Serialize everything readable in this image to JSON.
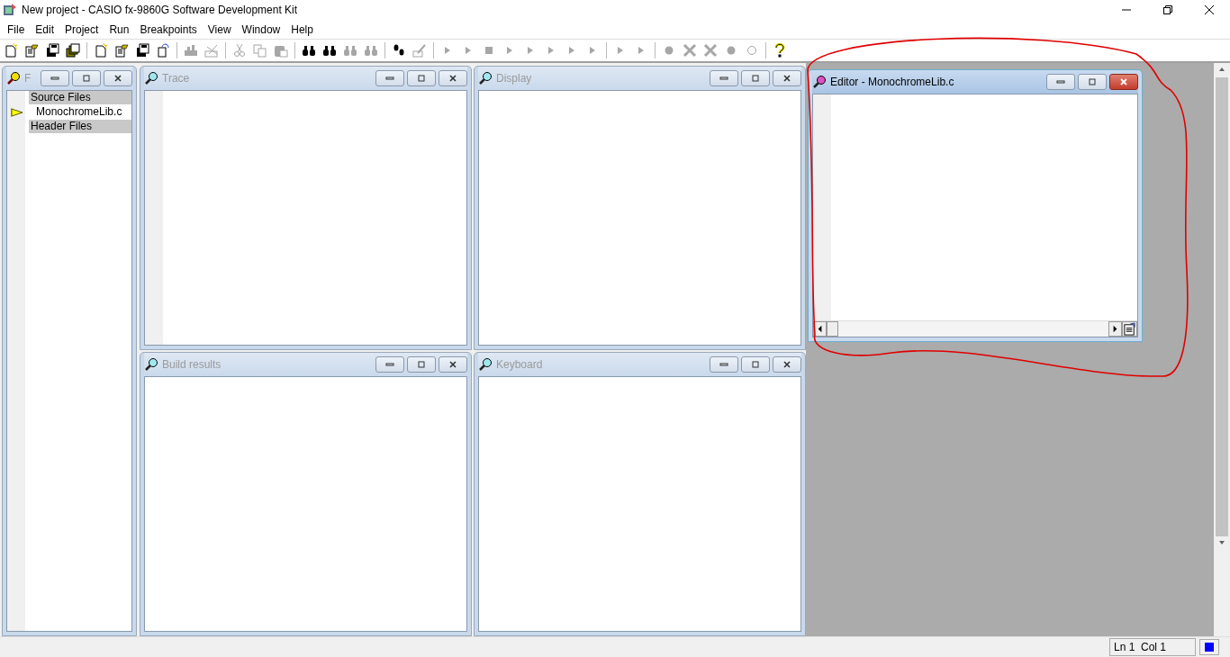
{
  "window": {
    "title": "New project - CASIO fx-9860G Software Development Kit"
  },
  "menu": [
    "File",
    "Edit",
    "Project",
    "Run",
    "Breakpoints",
    "View",
    "Window",
    "Help"
  ],
  "toolbar": [
    [
      {
        "kind": "new",
        "disabled": false
      },
      {
        "kind": "open",
        "disabled": false
      },
      {
        "kind": "save",
        "disabled": false
      },
      {
        "kind": "save-all",
        "disabled": false
      }
    ],
    [
      {
        "kind": "new",
        "disabled": false
      },
      {
        "kind": "open",
        "disabled": false
      },
      {
        "kind": "save",
        "disabled": false
      },
      {
        "kind": "revert",
        "disabled": false
      }
    ],
    [
      {
        "kind": "build",
        "disabled": true
      },
      {
        "kind": "clean",
        "disabled": true
      }
    ],
    [
      {
        "kind": "cut",
        "disabled": true
      },
      {
        "kind": "copy",
        "disabled": true
      },
      {
        "kind": "paste",
        "disabled": true
      }
    ],
    [
      {
        "kind": "find",
        "disabled": false
      },
      {
        "kind": "find",
        "disabled": false
      },
      {
        "kind": "find",
        "disabled": true
      },
      {
        "kind": "find",
        "disabled": true
      }
    ],
    [
      {
        "kind": "steps",
        "disabled": false
      },
      {
        "kind": "pen",
        "disabled": true
      }
    ],
    [
      {
        "kind": "play",
        "disabled": true
      },
      {
        "kind": "play",
        "disabled": true
      },
      {
        "kind": "stop",
        "disabled": true
      },
      {
        "kind": "play",
        "disabled": true
      },
      {
        "kind": "play",
        "disabled": true
      },
      {
        "kind": "play",
        "disabled": true
      },
      {
        "kind": "play",
        "disabled": true
      },
      {
        "kind": "play",
        "disabled": true
      }
    ],
    [
      {
        "kind": "play",
        "disabled": true
      },
      {
        "kind": "play",
        "disabled": true
      }
    ],
    [
      {
        "kind": "dot",
        "disabled": true
      },
      {
        "kind": "cross",
        "disabled": true
      },
      {
        "kind": "cross",
        "disabled": true
      },
      {
        "kind": "dot",
        "disabled": true
      },
      {
        "kind": "ring",
        "disabled": true
      }
    ],
    [
      {
        "kind": "help",
        "disabled": false
      }
    ]
  ],
  "files_panel": {
    "title": "F",
    "items": [
      {
        "kind": "group",
        "label": "Source Files",
        "current": false
      },
      {
        "kind": "file",
        "label": "MonochromeLib.c",
        "current": true
      },
      {
        "kind": "group",
        "label": "Header Files",
        "current": false
      }
    ]
  },
  "panels": [
    {
      "title": "Trace",
      "gutter": true,
      "active": false
    },
    {
      "title": "Display",
      "gutter": false,
      "active": false
    },
    {
      "title": "Build results",
      "gutter": false,
      "active": false
    },
    {
      "title": "Keyboard",
      "gutter": false,
      "active": false
    }
  ],
  "editor": {
    "title": "Editor - MonochromeLib.c",
    "gutter": true,
    "active": true
  },
  "status_bar": {
    "position": "Ln 1  Col 1"
  }
}
